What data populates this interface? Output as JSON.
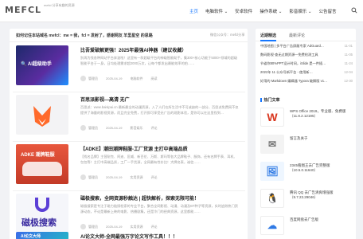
{
  "header": {
    "logo": "MEFCL",
    "logo_sub": "mefcl 分享有趣的资源",
    "nav": [
      "主页",
      "电脑软件",
      "安卓软件",
      "操作系统",
      "影音娱乐",
      "公告留言"
    ],
    "nav_caret": "⌄"
  },
  "notice": {
    "text": "如何记住本站域名 mefcl：me = 我，fcl = 发射了，感谢网友 羊里星空 的思路",
    "right": "微信公众号：mefcl分享"
  },
  "articles": [
    {
      "title": "比吾爱破解更强！2025年最强AI神器（建议收藏）",
      "badge": "",
      "desc": "别再为找各种网站平台奔波啦！这里有一款超级平台的神级智能助手，集300+核心功能于5000+领域的超级智能平台于一身，日均处理需求超2000万次，让每个都发出最能效率的拍……",
      "author": "管理员",
      "date": "2025-04-19",
      "cat": "电脑软件",
      "views": "阅读",
      "thumb_text": "🔍 AI超级助手",
      "thumb_bg": "#1d2a6b"
    },
    {
      "title": "百思派影视—高清 无广",
      "badge": "",
      "desc": "百思派：www.baisipai.cn 最新最全的动漫资源，入了人们在所生活中不可或缺的一部分，百思派免费网不仅提供了海量的影视资源，而且完全免费，打开即可享受无广告的观影体验，是你可以在这里找到…",
      "author": "管理员",
      "date": "2025-04-19",
      "cat": "影音娱乐",
      "views": "评论",
      "thumb_text": "🦊",
      "thumb_bg": "#f3f3f5"
    },
    {
      "title": "【ADKE】潮田潮牌鞋服-工厂货源 主打中高端品质",
      "badge": "",
      "desc": "【找名品牌】主营耐克、阿迪、匡威、新百伦、万斯、斯玛等各大品牌鞋子、服饰，还有名牌手表、耳机、包包等！主打中高端品质，工厂一手货源，全网最有性价比！大牌名表，诚信……",
      "author": "管理员",
      "date": "2025-04-19",
      "cat": "实用资源",
      "views": "评论",
      "thumb_text": "ADKE 潮牌鞋服",
      "thumb_bg": "#e8573d"
    },
    {
      "title": "磁极搜索，全网资源秒触达 | 超快解析，探索无限可能！",
      "badge": "",
      "desc": "磁极搜索是专注于磁力链接检索的专业平台，聚合全网影视、动漫、动漫及BT种子等资源，实时追踪热门资源动态，不论是最新上映的电影、热播剧集，还是冷门的经典资源，这里都能……",
      "author": "管理员",
      "date": "2025-04-19",
      "cat": "实用资源",
      "views": "评论",
      "thumb_text": "磁极搜索",
      "thumb_bg": "#f5f6fa"
    },
    {
      "title": "AI论文大师-全网最强万字论文写作工具！！！",
      "badge": "",
      "desc": "",
      "author": "",
      "date": "",
      "cat": "",
      "views": "",
      "thumb_text": "AI论文大师",
      "thumb_bg": "#3b6ce8"
    }
  ],
  "sidebar": {
    "tabs": [
      "近期精选",
      "最新评论"
    ],
    "news": [
      {
        "title": "中国地图 | 多平台广告屏蔽专家 AdGuard…",
        "date": "11-01"
      },
      {
        "title": "数码影视·查无过期资源—免费检测工具",
        "date": "11-05"
      },
      {
        "title": "节省你80%PPT设计时间，iSlide 是一件插…",
        "date": "11-24"
      },
      {
        "title": "2022年 11 公众号新平台 - 使用新…",
        "date": "12-04"
      },
      {
        "title": "好用的 Markdown 编辑器 Typora 破解版 v1…",
        "date": "12-30"
      }
    ],
    "hot_title": "热门文章",
    "hot": [
      {
        "name": "WPS Office 2019，专业版、免费版（11.8.2.12195）",
        "icon": "W",
        "bg": "#fff",
        "fg": "#d9361e"
      },
      {
        "name": "留言及关于",
        "icon": "✉",
        "bg": "#f3f3f3",
        "fg": "#777"
      },
      {
        "name": "2345看图王去广告完整版（10.5.0.11640）",
        "icon": "🖼",
        "bg": "#eef6ff",
        "fg": "#2f7ae5"
      },
      {
        "name": "腾讯 QQ 去广告清爽增强版（9.7.23.29046）",
        "icon": "🐧",
        "bg": "#fff",
        "fg": "#222"
      },
      {
        "name": "百度网盘去广告版",
        "icon": "☁",
        "bg": "#fff",
        "fg": "#2f7ae5"
      }
    ]
  }
}
